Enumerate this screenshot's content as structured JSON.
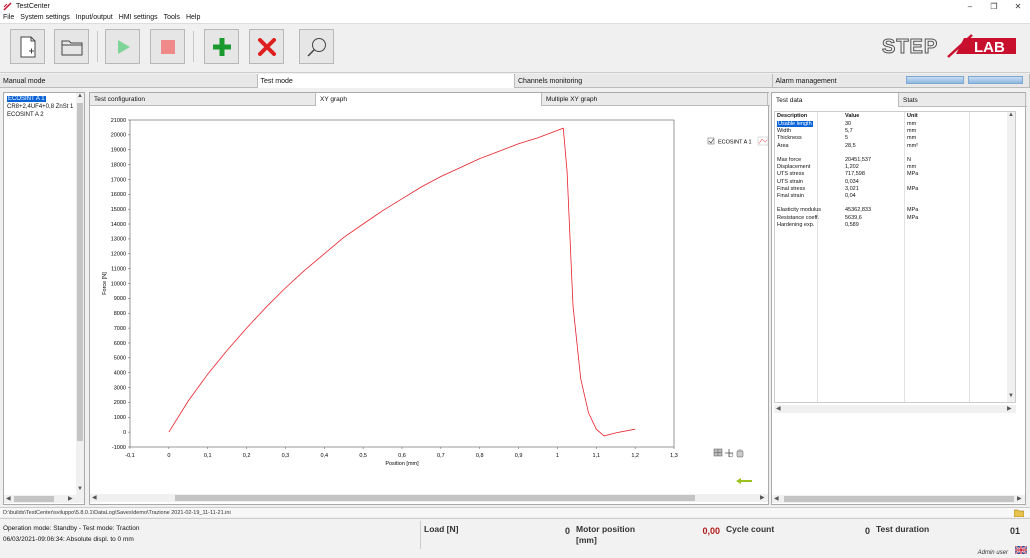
{
  "window": {
    "title": "TestCenter"
  },
  "menu": [
    "File",
    "System settings",
    "Input/output",
    "HMI settings",
    "Tools",
    "Help"
  ],
  "modes": [
    {
      "label": "Manual mode"
    },
    {
      "label": "Test mode"
    },
    {
      "label": "Channels monitoring"
    },
    {
      "label": "Alarm management"
    }
  ],
  "logo": {
    "text_left": "STEP",
    "text_right": "LAB"
  },
  "tree": {
    "items": [
      "ECOSINT A 1",
      "CR8+2,4UF4+0,8 ZnSt 1",
      "ECOSINT A 2"
    ]
  },
  "center_tabs": [
    "Test configuration",
    "XY graph",
    "Multiple XY graph"
  ],
  "right_tabs": [
    "Test data",
    "Stats"
  ],
  "grid": {
    "headers": [
      "Description",
      "Value",
      "Unit"
    ],
    "rows": [
      [
        "Usable length",
        "30",
        "mm"
      ],
      [
        "Width",
        "5,7",
        "mm"
      ],
      [
        "Thickness",
        "5",
        "mm"
      ],
      [
        "Area",
        "28,5",
        "mm²"
      ],
      [
        "",
        "",
        ""
      ],
      [
        "Max force",
        "20451,537",
        "N"
      ],
      [
        "Displacement",
        "1,202",
        "mm"
      ],
      [
        "UTS stress",
        "717,598",
        "MPa"
      ],
      [
        "UTS strain",
        "0,034",
        ""
      ],
      [
        "Final stress",
        "3,021",
        "MPa"
      ],
      [
        "Final strain",
        "0,04",
        ""
      ],
      [
        "",
        "",
        ""
      ],
      [
        "Elasticity modulus",
        "45362,833",
        "MPa"
      ],
      [
        "Resistance coeff.",
        "5639,6",
        "MPa"
      ],
      [
        "Hardening exp.",
        "0,589",
        ""
      ]
    ]
  },
  "path": "D:\\builds\\TestCenter\\sviluppo\\5.8.0.1\\DataLog\\Saves\\demo\\Trazione 2021-02-19_11-11-21.ini",
  "status": {
    "line1": "Operation mode: Standby - Test mode: Traction",
    "line2": "06/03/2021-09:06:34: Absolute displ. to 0 mm",
    "load_label": "Load [N]",
    "load_value": "0",
    "motor_label_1": "Motor position",
    "motor_label_2": "[mm]",
    "motor_value": "0,00",
    "cycle_label": "Cycle count",
    "cycle_value": "0",
    "duration_label": "Test duration",
    "duration_value": "01",
    "user": "Admin user"
  },
  "colors": {
    "curve": "#e8202a",
    "selection": "#0a64d8",
    "accent_red": "#c8102e"
  },
  "chart_data": {
    "type": "line",
    "xlabel": "Position [mm]",
    "ylabel": "Force [N]",
    "xlim": [
      -0.1,
      1.3
    ],
    "ylim": [
      -1000,
      21000
    ],
    "x_ticks": [
      "-0,1",
      "0",
      "0,1",
      "0,2",
      "0,3",
      "0,4",
      "0,5",
      "0,6",
      "0,7",
      "0,8",
      "0,9",
      "1",
      "1,1",
      "1,2",
      "1,3"
    ],
    "y_ticks": [
      "-1000",
      "0",
      "1000",
      "2000",
      "3000",
      "4000",
      "5000",
      "6000",
      "7000",
      "8000",
      "9000",
      "10000",
      "11000",
      "12000",
      "13000",
      "14000",
      "15000",
      "16000",
      "17000",
      "18000",
      "19000",
      "20000",
      "21000"
    ],
    "legend": "top-right",
    "series": [
      {
        "name": "ECOSINT A 1",
        "x": [
          0,
          0.05,
          0.1,
          0.15,
          0.2,
          0.25,
          0.3,
          0.35,
          0.4,
          0.45,
          0.5,
          0.55,
          0.6,
          0.65,
          0.7,
          0.75,
          0.8,
          0.85,
          0.9,
          0.95,
          1.0,
          1.015,
          1.025,
          1.04,
          1.06,
          1.08,
          1.1,
          1.12,
          1.15,
          1.2
        ],
        "y": [
          0,
          2100,
          3900,
          5500,
          7000,
          8400,
          9700,
          10900,
          12000,
          13100,
          14000,
          14900,
          15700,
          16500,
          17200,
          17800,
          18400,
          18900,
          19400,
          19800,
          20300,
          20451,
          17500,
          8500,
          3600,
          1300,
          200,
          -250,
          -50,
          200
        ]
      }
    ]
  }
}
